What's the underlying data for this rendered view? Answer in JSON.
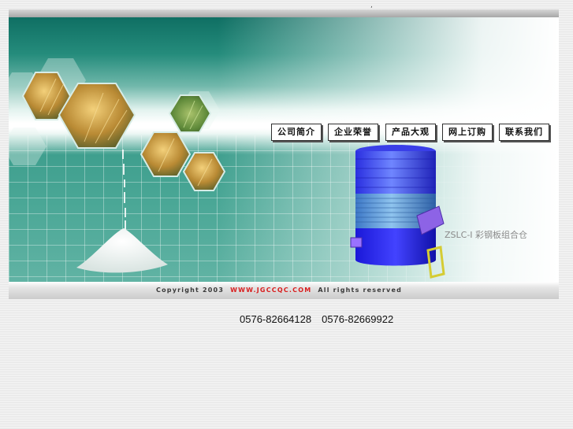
{
  "top_marks": ", ”",
  "nav": {
    "items": [
      {
        "label": "公司简介"
      },
      {
        "label": "企业荣誉"
      },
      {
        "label": "产品大观"
      },
      {
        "label": "网上订购"
      },
      {
        "label": "联系我们"
      }
    ]
  },
  "product": {
    "label": "ZSLC-I 彩钢板组合仓"
  },
  "footer": {
    "copyright_prefix": "Copyright 2003",
    "url": "WWW.JGCCQC.COM",
    "rights": "All rights reserved"
  },
  "contact": {
    "phone_1": "0576-82664128",
    "phone_2": "0576-82669922"
  },
  "colors": {
    "teal_dark": "#0f6f63",
    "teal_mid": "#4aa796",
    "url_red": "#d81e1e",
    "silo_blue": "#2f3cff"
  }
}
